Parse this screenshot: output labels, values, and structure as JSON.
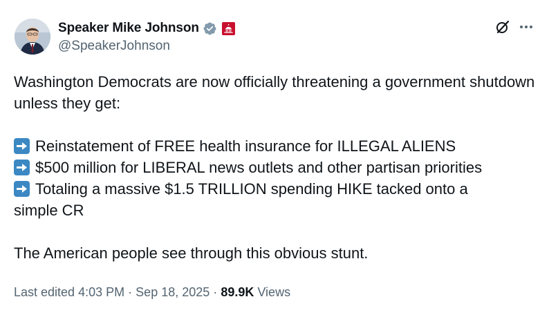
{
  "author": {
    "display_name": "Speaker Mike Johnson",
    "handle": "@SpeakerJohnson",
    "verified_icon": "verified-badge-icon",
    "affiliation_icon": "capitol-affiliation-badge-icon",
    "avatar": "avatar"
  },
  "actions": {
    "grok_icon": "grok-icon",
    "more_icon": "more-options-icon"
  },
  "post": {
    "intro": "Washington Democrats are now officially threatening a government shutdown unless they get:",
    "items": [
      "Reinstatement of FREE health insurance for ILLEGAL ALIENS",
      "$500 million for LIBERAL news outlets and other partisan priorities",
      "Totaling a massive $1.5 TRILLION spending HIKE tacked onto a simple CR"
    ],
    "closing": "The American people see through this obvious stunt."
  },
  "meta": {
    "edited_label": "Last edited",
    "time": "4:03 PM",
    "separator": "·",
    "date": "Sep 18, 2025",
    "views_count": "89.9K",
    "views_label": "Views"
  },
  "colors": {
    "text": "#0f1419",
    "secondary": "#536471",
    "verified": "#829aab",
    "arrow_emoji": "#3b88c3",
    "affiliation": "#c8102e"
  }
}
